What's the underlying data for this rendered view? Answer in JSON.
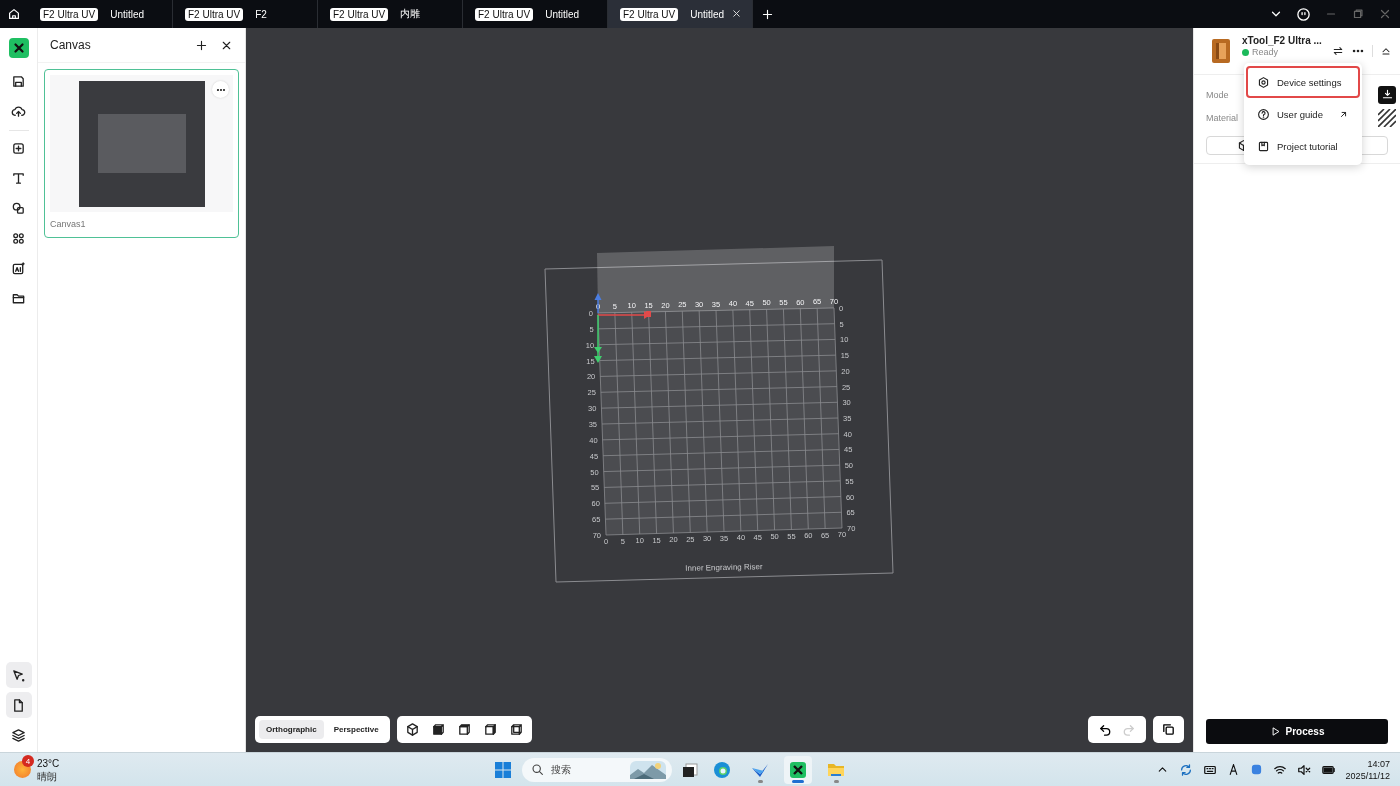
{
  "tabs": [
    {
      "badge": "F2 Ultra UV",
      "title": "Untitled",
      "selected": false
    },
    {
      "badge": "F2 Ultra UV",
      "title": "F2",
      "selected": false
    },
    {
      "badge": "F2 Ultra UV",
      "title": "内雕",
      "selected": false
    },
    {
      "badge": "F2 Ultra UV",
      "title": "Untitled",
      "selected": false
    },
    {
      "badge": "F2 Ultra UV",
      "title": "Untitled",
      "selected": true
    }
  ],
  "rail": {
    "bottom_tools": [
      {
        "selected": true
      },
      {
        "selected": true
      },
      {
        "selected": false
      }
    ]
  },
  "canvas_panel": {
    "title": "Canvas",
    "cards": [
      {
        "name": "Canvas1",
        "selected": true
      }
    ]
  },
  "viewport": {
    "grid": {
      "top_ticks": [
        "0",
        "5",
        "10",
        "15",
        "20",
        "25",
        "30",
        "35",
        "40",
        "45",
        "50",
        "55",
        "60",
        "65",
        "70"
      ],
      "left_ticks": [
        "0",
        "5",
        "10",
        "15",
        "20",
        "25",
        "30",
        "35",
        "40",
        "45",
        "50",
        "55",
        "60",
        "65",
        "70"
      ],
      "right_ticks": [
        "0",
        "5",
        "10",
        "15",
        "20",
        "25",
        "30",
        "35",
        "40",
        "45",
        "50",
        "55",
        "60",
        "65",
        "70"
      ],
      "bottom_ticks": [
        "0",
        "5",
        "10",
        "15",
        "20",
        "25",
        "30",
        "35",
        "40",
        "45",
        "50",
        "55",
        "60",
        "65",
        "70"
      ]
    },
    "platform_label": "Inner Engraving Riser",
    "view_modes": [
      {
        "label": "Orthographic",
        "selected": true
      },
      {
        "label": "Perspective",
        "selected": false
      }
    ],
    "undo": {
      "disabled": false
    },
    "redo": {
      "disabled": true
    }
  },
  "device": {
    "name": "xTool_F2 Ultra ...",
    "status": "Ready",
    "fields": [
      {
        "label": "Mode"
      },
      {
        "label": "Material"
      }
    ]
  },
  "device_menu": [
    {
      "label": "Device settings",
      "selected": true
    },
    {
      "label": "User guide",
      "selected": false
    },
    {
      "label": "Project tutorial",
      "selected": false
    }
  ],
  "process_button": "Process",
  "taskbar": {
    "weather": {
      "badge": "4",
      "temperature": "23°C",
      "condition": "晴朗"
    },
    "search": {
      "placeholder": "搜索"
    },
    "apps": [
      {
        "running": false,
        "active": false
      },
      {
        "running": true,
        "active": false
      },
      {
        "running": true,
        "active": true
      },
      {
        "running": true,
        "active": false
      }
    ],
    "clock": {
      "time": "14:07",
      "date": "2025/11/12"
    }
  }
}
